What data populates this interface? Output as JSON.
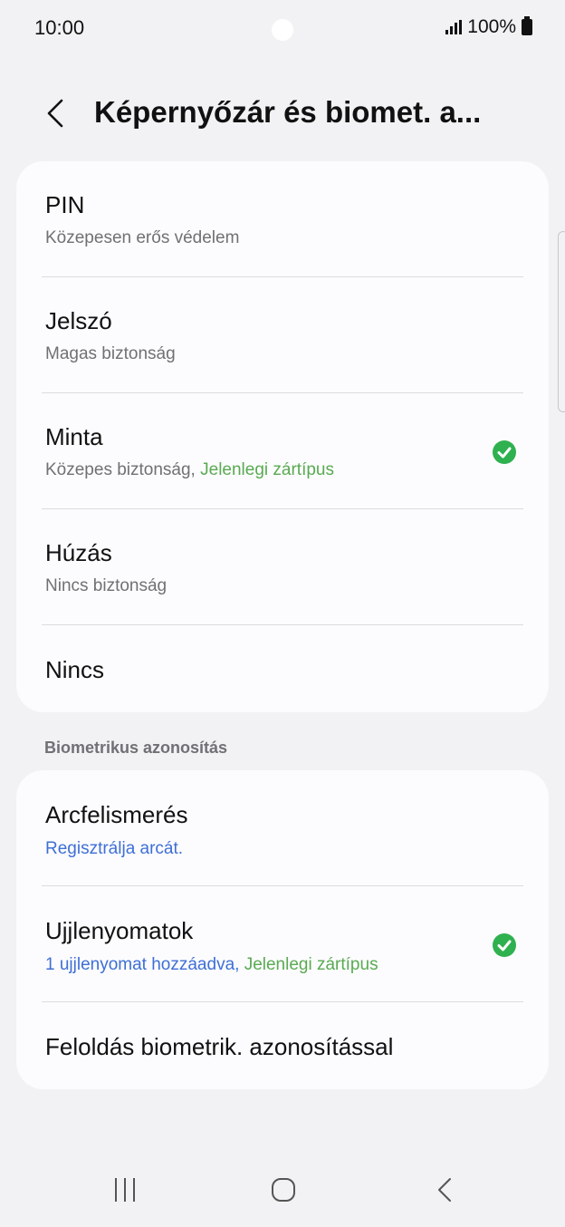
{
  "status_bar": {
    "time": "10:00",
    "battery": "100%"
  },
  "header": {
    "title": "Képernyőzár és biomet. a..."
  },
  "lock_types": [
    {
      "title": "PIN",
      "subtitle": "Közepesen erős védelem"
    },
    {
      "title": "Jelszó",
      "subtitle": "Magas biztonság"
    },
    {
      "title": "Minta",
      "subtitle": "Közepes biztonság,",
      "subtitle_extra": "Jelenlegi zártípus",
      "selected": true
    },
    {
      "title": "Húzás",
      "subtitle": "Nincs biztonság"
    },
    {
      "title": "Nincs"
    }
  ],
  "biometrics": {
    "section_label": "Biometrikus azonosítás",
    "items": [
      {
        "title": "Arcfelismerés",
        "subtitle": "Regisztrálja arcát."
      },
      {
        "title": "Ujjlenyomatok",
        "subtitle": "1 ujjlenyomat hozzáadva,",
        "subtitle_extra": "Jelenlegi zártípus",
        "selected": true
      },
      {
        "title": "Feloldás biometrik. azonosítással"
      }
    ]
  },
  "colors": {
    "accent_blue": "#3e6fd6",
    "current_green": "#5aaa52",
    "check_green": "#2fb14f"
  },
  "icons": {
    "back": "chevron-left-icon",
    "check": "check-circle-icon",
    "nav_recent": "recent-apps-icon",
    "nav_home": "home-icon",
    "nav_back": "back-icon"
  }
}
